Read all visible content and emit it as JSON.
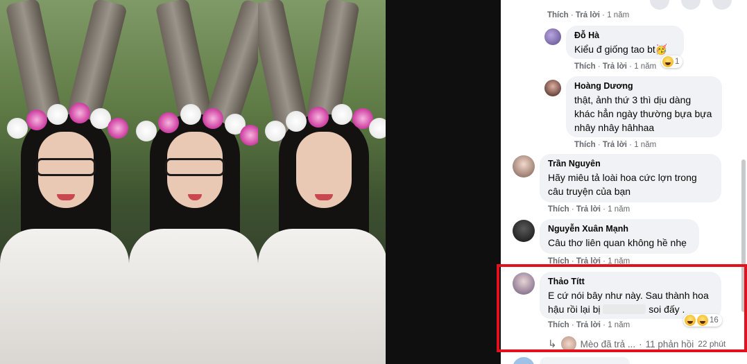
{
  "actions": {
    "like": "Thích",
    "reply": "Trả lời",
    "sep": "·"
  },
  "top_comment": {
    "time": "1 năm"
  },
  "comments": [
    {
      "name": "Đỗ Hà",
      "text": "Kiểu đ giống tao bt🥳",
      "time": "1 năm",
      "reactions": "1"
    },
    {
      "name": "Hoàng Dương",
      "text": "thật, ảnh thứ 3 thì dịu dàng khác hẳn ngày thường bựa bựa nhây nhây hâhhaa",
      "time": "1 năm"
    },
    {
      "name": "Trần Nguyên",
      "text": "Hãy miêu tả loài hoa cức lợn trong câu truyện của bạn",
      "time": "1 năm"
    },
    {
      "name": "Nguyễn Xuân Mạnh",
      "text": "Câu thơ liên quan không hề nhẹ",
      "time": "1 năm"
    },
    {
      "name": "Thảo Títt",
      "text_before": "E cứ nói bây như này. Sau thành hoa hậu rồi lại bị",
      "text_after": "soi đấy .",
      "time": "1 năm",
      "reactions": "16"
    }
  ],
  "replies_summary": {
    "author": "Mèo đã trả ...",
    "count": "11 phản hồi",
    "time": "22 phút"
  },
  "colors": {
    "highlight": "#e0121d",
    "bubble": "#f0f2f5",
    "meta": "#65676b"
  }
}
